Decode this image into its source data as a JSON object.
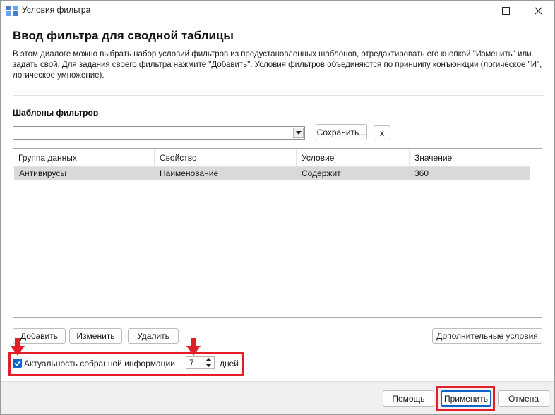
{
  "window": {
    "title": "Условия фильтра",
    "minimize_icon": "minimize-icon",
    "maximize_icon": "maximize-icon",
    "close_icon": "close-icon"
  },
  "header": {
    "heading": "Ввод фильтра для сводной таблицы",
    "description": "В этом диалоге можно выбрать набор условий фильтров из предустановленных шаблонов, отредактировать его кнопкой \"Изменить\" или задать свой. Для задания своего фильтра нажмите \"Добавить\". Условия фильтров объединяются по принципу конъюнкции (логическое \"И\", логическое умножение)."
  },
  "templates": {
    "label": "Шаблоны фильтров",
    "selected_value": "",
    "save_label": "Сохранить...",
    "remove_label": "x"
  },
  "table": {
    "columns": [
      "Группа данных",
      "Свойство",
      "Условие",
      "Значение"
    ],
    "rows": [
      [
        "Антивирусы",
        "Наименование",
        "Содержит",
        "360"
      ]
    ]
  },
  "actions": {
    "add_label": "Добавить",
    "edit_label": "Изменить",
    "delete_label": "Удалить",
    "extra_label": "Дополнительные условия"
  },
  "freshness": {
    "checked": true,
    "label": "Актуальность собранной информации",
    "value": "7",
    "unit": "дней"
  },
  "footer": {
    "help_label": "Помощь",
    "apply_label": "Применить",
    "cancel_label": "Отмена"
  },
  "colors": {
    "highlight": "#e41e26",
    "checkbox": "#0d63c8",
    "selected_row": "#d9d9d9"
  }
}
